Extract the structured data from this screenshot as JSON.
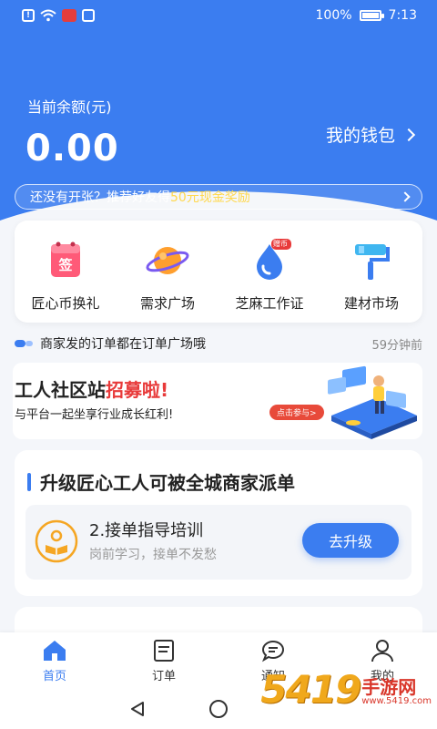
{
  "status_bar": {
    "battery": "100%",
    "battery_level": 1.0,
    "time": "7:13"
  },
  "balance": {
    "label": "当前余额(元)",
    "value": "0.00",
    "wallet_link": "我的钱包"
  },
  "invite": {
    "text_before": "还没有开张？推荐好友得",
    "highlight": "50元现金奖励",
    "highlight_color": "#ffd84d"
  },
  "quick_actions": [
    {
      "label": "匠心币换礼",
      "icon": "gift-tag-icon"
    },
    {
      "label": "需求广场",
      "icon": "planet-icon"
    },
    {
      "label": "芝麻工作证",
      "icon": "water-drop-badge-icon",
      "badge": "赠币"
    },
    {
      "label": "建材市场",
      "icon": "paint-roller-icon"
    }
  ],
  "notice": {
    "text": "商家发的订单都在订单广场哦",
    "time": "59分钟前"
  },
  "banner": {
    "title_prefix": "工人社区站",
    "title_highlight": "招募啦!",
    "subtitle": "与平台一起坐享行业成长红利!",
    "pill": "点击参与>"
  },
  "upgrade": {
    "title": "升级匠心工人可被全城商家派单",
    "item_name": "2.接单指导培训",
    "item_desc": "岗前学习，接单不发愁",
    "button": "去升级"
  },
  "tabs": [
    {
      "label": "首页",
      "icon": "home-icon",
      "active": true
    },
    {
      "label": "订单",
      "icon": "order-list-icon",
      "active": false
    },
    {
      "label": "通知",
      "icon": "chat-bubble-icon",
      "active": false
    },
    {
      "label": "我的",
      "icon": "person-icon",
      "active": false
    }
  ],
  "watermark": {
    "big": "5419",
    "cn": "手游网",
    "url": "www.5419.com"
  },
  "colors": {
    "brand": "#3b7df0",
    "accent_red": "#e83a3a",
    "page_bg": "#f4f6fa"
  }
}
